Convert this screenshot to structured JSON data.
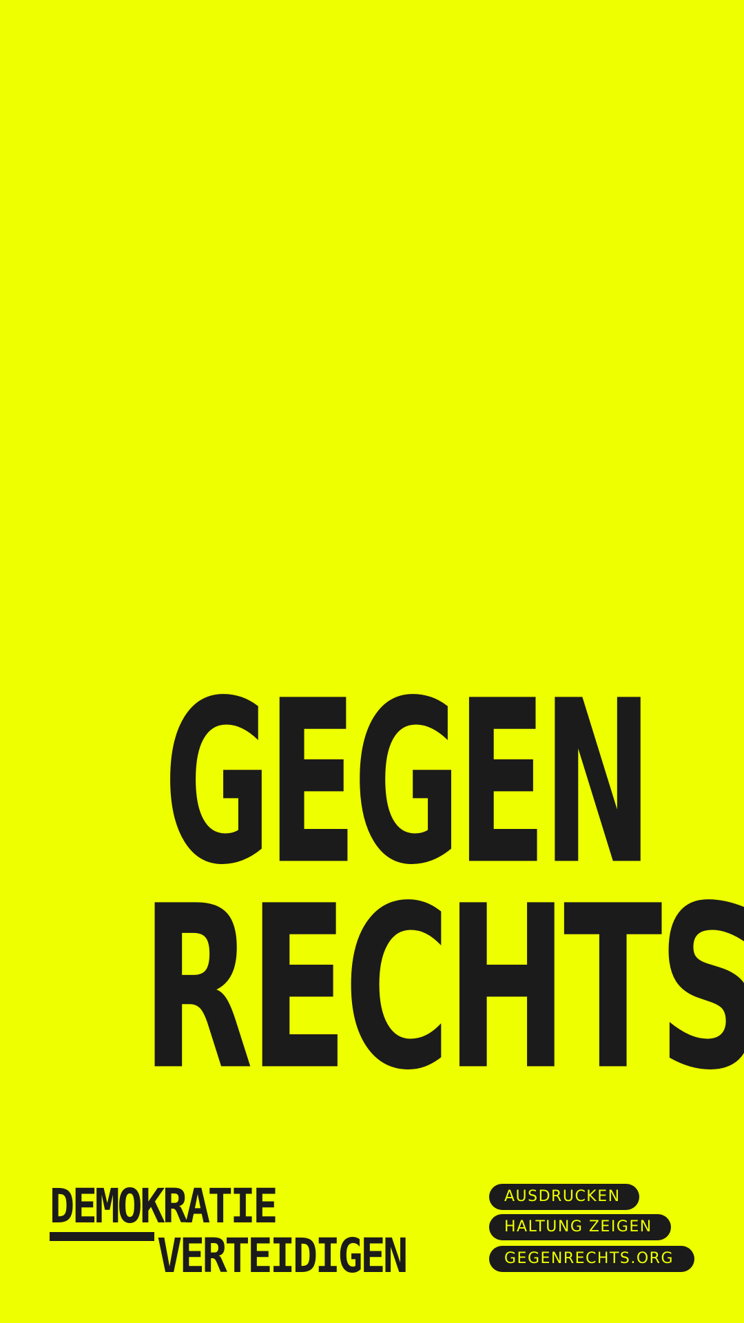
{
  "colors": {
    "background": "#EEFF00",
    "ink": "#1B1B1B"
  },
  "headline": {
    "line1": "GEGEN",
    "line2": "RECHTS"
  },
  "logo": {
    "line1": "DEMOKRATIE",
    "line2": "VERTEIDIGEN"
  },
  "pills": [
    {
      "label": "AUSDRUCKEN"
    },
    {
      "label": "HALTUNG ZEIGEN"
    },
    {
      "label": "GEGENRECHTS.ORG"
    }
  ]
}
